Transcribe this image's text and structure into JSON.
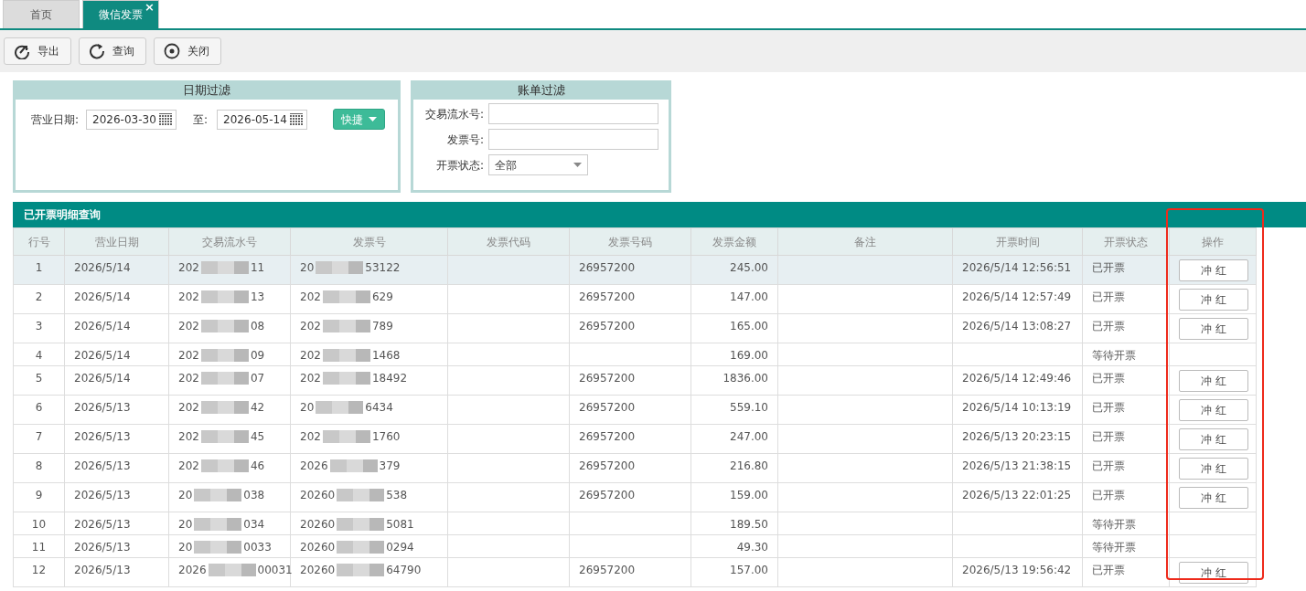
{
  "tabs": [
    {
      "label": "首页",
      "selected": false
    },
    {
      "label": "微信发票",
      "selected": true,
      "close": "×"
    }
  ],
  "toolbar": [
    {
      "label": "导出",
      "kind": "export"
    },
    {
      "label": "查询",
      "kind": "refresh"
    },
    {
      "label": "关闭",
      "kind": "close"
    }
  ],
  "date_filter": {
    "title": "日期过滤",
    "date_label": "营业日期:",
    "start": "2026-03-30",
    "to_label": "至:",
    "end": "2026-05-14",
    "quick_button": "快捷"
  },
  "bill_filter": {
    "title": "账单过滤",
    "fields": [
      {
        "label": "交易流水号:",
        "kind": "text"
      },
      {
        "label": "发票号:",
        "kind": "text"
      },
      {
        "label": "开票状态:",
        "kind": "select",
        "value": "全部"
      }
    ]
  },
  "table": {
    "title": "已开票明细查询",
    "columns": [
      {
        "label": "行号",
        "highlighted": false
      },
      {
        "label": "营业日期",
        "highlighted": false
      },
      {
        "label": "交易流水号",
        "highlighted": false
      },
      {
        "label": "发票号",
        "highlighted": false
      },
      {
        "label": "发票代码",
        "highlighted": false
      },
      {
        "label": "发票号码",
        "highlighted": false
      },
      {
        "label": "发票金额",
        "highlighted": false
      },
      {
        "label": "备注",
        "highlighted": false
      },
      {
        "label": "开票时间",
        "highlighted": false
      },
      {
        "label": "开票状态",
        "highlighted": false
      },
      {
        "label": "操作",
        "highlighted": true
      }
    ],
    "rows": [
      {
        "selected": true,
        "no": "1",
        "date": "2026/5/14",
        "serial": {
          "head": "202",
          "tail": "11"
        },
        "invoice": {
          "head": "20",
          "tail": "53122"
        },
        "number": "26957200",
        "amount": "245.00",
        "time": "2026/5/14 12:56:51",
        "status": "已开票",
        "action": "冲 红"
      },
      {
        "selected": false,
        "no": "2",
        "date": "2026/5/14",
        "serial": {
          "head": "202",
          "tail": "13"
        },
        "invoice": {
          "head": "202",
          "tail": "629"
        },
        "number": "26957200",
        "amount": "147.00",
        "time": "2026/5/14 12:57:49",
        "status": "已开票",
        "action": "冲 红"
      },
      {
        "selected": false,
        "no": "3",
        "date": "2026/5/14",
        "serial": {
          "head": "202",
          "tail": "08"
        },
        "invoice": {
          "head": "202",
          "tail": "789"
        },
        "number": "26957200",
        "amount": "165.00",
        "time": "2026/5/14 13:08:27",
        "status": "已开票",
        "action": "冲 红"
      },
      {
        "selected": false,
        "no": "4",
        "date": "2026/5/14",
        "serial": {
          "head": "202",
          "tail": "09"
        },
        "invoice": {
          "head": "202",
          "tail": "1468"
        },
        "amount": "169.00",
        "status": "等待开票"
      },
      {
        "selected": false,
        "no": "5",
        "date": "2026/5/14",
        "serial": {
          "head": "202",
          "tail": "07"
        },
        "invoice": {
          "head": "202",
          "tail": "18492"
        },
        "number": "26957200",
        "amount": "1836.00",
        "time": "2026/5/14 12:49:46",
        "status": "已开票",
        "action": "冲 红"
      },
      {
        "selected": false,
        "no": "6",
        "date": "2026/5/13",
        "serial": {
          "head": "202",
          "tail": "42"
        },
        "invoice": {
          "head": "20",
          "tail": "6434"
        },
        "number": "26957200",
        "amount": "559.10",
        "time": "2026/5/14 10:13:19",
        "status": "已开票",
        "action": "冲 红"
      },
      {
        "selected": false,
        "no": "7",
        "date": "2026/5/13",
        "serial": {
          "head": "202",
          "tail": "45"
        },
        "invoice": {
          "head": "202",
          "tail": "1760"
        },
        "number": "26957200",
        "amount": "247.00",
        "time": "2026/5/13 20:23:15",
        "status": "已开票",
        "action": "冲 红"
      },
      {
        "selected": false,
        "no": "8",
        "date": "2026/5/13",
        "serial": {
          "head": "202",
          "tail": "46"
        },
        "invoice": {
          "head": "2026",
          "tail": "379"
        },
        "number": "26957200",
        "amount": "216.80",
        "time": "2026/5/13 21:38:15",
        "status": "已开票",
        "action": "冲 红"
      },
      {
        "selected": false,
        "no": "9",
        "date": "2026/5/13",
        "serial": {
          "head": "20",
          "tail": "038"
        },
        "invoice": {
          "head": "20260",
          "tail": "538"
        },
        "number": "26957200",
        "amount": "159.00",
        "time": "2026/5/13 22:01:25",
        "status": "已开票",
        "action": "冲 红"
      },
      {
        "selected": false,
        "no": "10",
        "date": "2026/5/13",
        "serial": {
          "head": "20",
          "tail": "034"
        },
        "invoice": {
          "head": "20260",
          "tail": "5081"
        },
        "amount": "189.50",
        "status": "等待开票"
      },
      {
        "selected": false,
        "no": "11",
        "date": "2026/5/13",
        "serial": {
          "head": "20",
          "tail": "0033"
        },
        "invoice": {
          "head": "20260",
          "tail": "0294"
        },
        "amount": "49.30",
        "status": "等待开票"
      },
      {
        "selected": false,
        "no": "12",
        "date": "2026/5/13",
        "serial": {
          "head": "2026",
          "tail": "00031"
        },
        "invoice": {
          "head": "20260",
          "tail": "64790"
        },
        "number": "26957200",
        "amount": "157.00",
        "time": "2026/5/13 19:56:42",
        "status": "已开票",
        "action": "冲 红"
      }
    ]
  }
}
